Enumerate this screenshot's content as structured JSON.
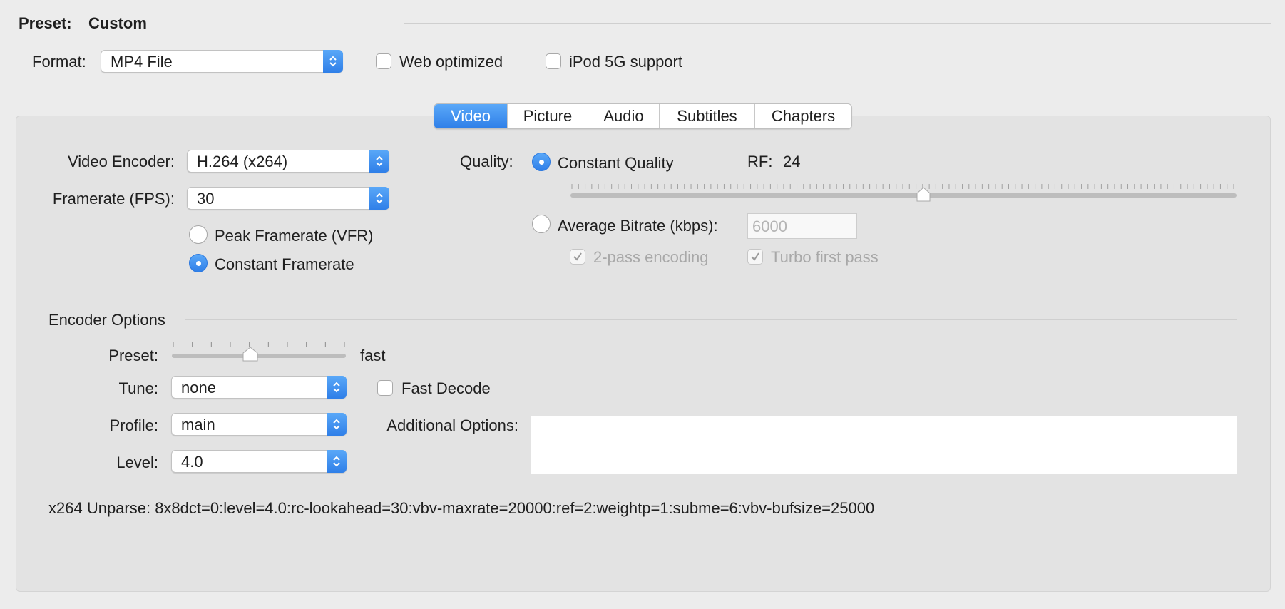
{
  "preset": {
    "label": "Preset:",
    "value": "Custom"
  },
  "format": {
    "label": "Format:",
    "selected": "MP4 File",
    "web_optimized": {
      "label": "Web optimized",
      "checked": false
    },
    "ipod_support": {
      "label": "iPod 5G support",
      "checked": false
    }
  },
  "tabs": [
    {
      "label": "Video",
      "active": true
    },
    {
      "label": "Picture",
      "active": false
    },
    {
      "label": "Audio",
      "active": false
    },
    {
      "label": "Subtitles",
      "active": false
    },
    {
      "label": "Chapters",
      "active": false
    }
  ],
  "video": {
    "encoder_label": "Video Encoder:",
    "encoder": "H.264 (x264)",
    "framerate_label": "Framerate (FPS):",
    "framerate": "30",
    "peak_vfr": {
      "label": "Peak Framerate (VFR)",
      "selected": false
    },
    "constant_fr": {
      "label": "Constant Framerate",
      "selected": true
    }
  },
  "quality": {
    "label": "Quality:",
    "constant_quality": {
      "label": "Constant Quality",
      "selected": true
    },
    "rf_label": "RF:",
    "rf_value": "24",
    "rf_slider_fraction": 0.53,
    "average_bitrate": {
      "label": "Average Bitrate (kbps):",
      "selected": false
    },
    "bitrate_placeholder": "6000",
    "two_pass": {
      "label": "2-pass encoding",
      "checked": true,
      "enabled": false
    },
    "turbo": {
      "label": "Turbo first pass",
      "checked": true,
      "enabled": false
    }
  },
  "encoder_options": {
    "header": "Encoder Options",
    "preset_label": "Preset:",
    "preset_value": "fast",
    "preset_slider_fraction": 0.45,
    "tune_label": "Tune:",
    "tune": "none",
    "fast_decode": {
      "label": "Fast Decode",
      "checked": false
    },
    "profile_label": "Profile:",
    "profile": "main",
    "additional_label": "Additional Options:",
    "additional_value": "",
    "level_label": "Level:",
    "level": "4.0"
  },
  "unparse": "x264 Unparse: 8x8dct=0:level=4.0:rc-lookahead=30:vbv-maxrate=20000:ref=2:weightp=1:subme=6:vbv-bufsize=25000",
  "colors": {
    "accent": "#2f7fe8",
    "panel": "#e3e3e3",
    "window": "#ececec"
  }
}
